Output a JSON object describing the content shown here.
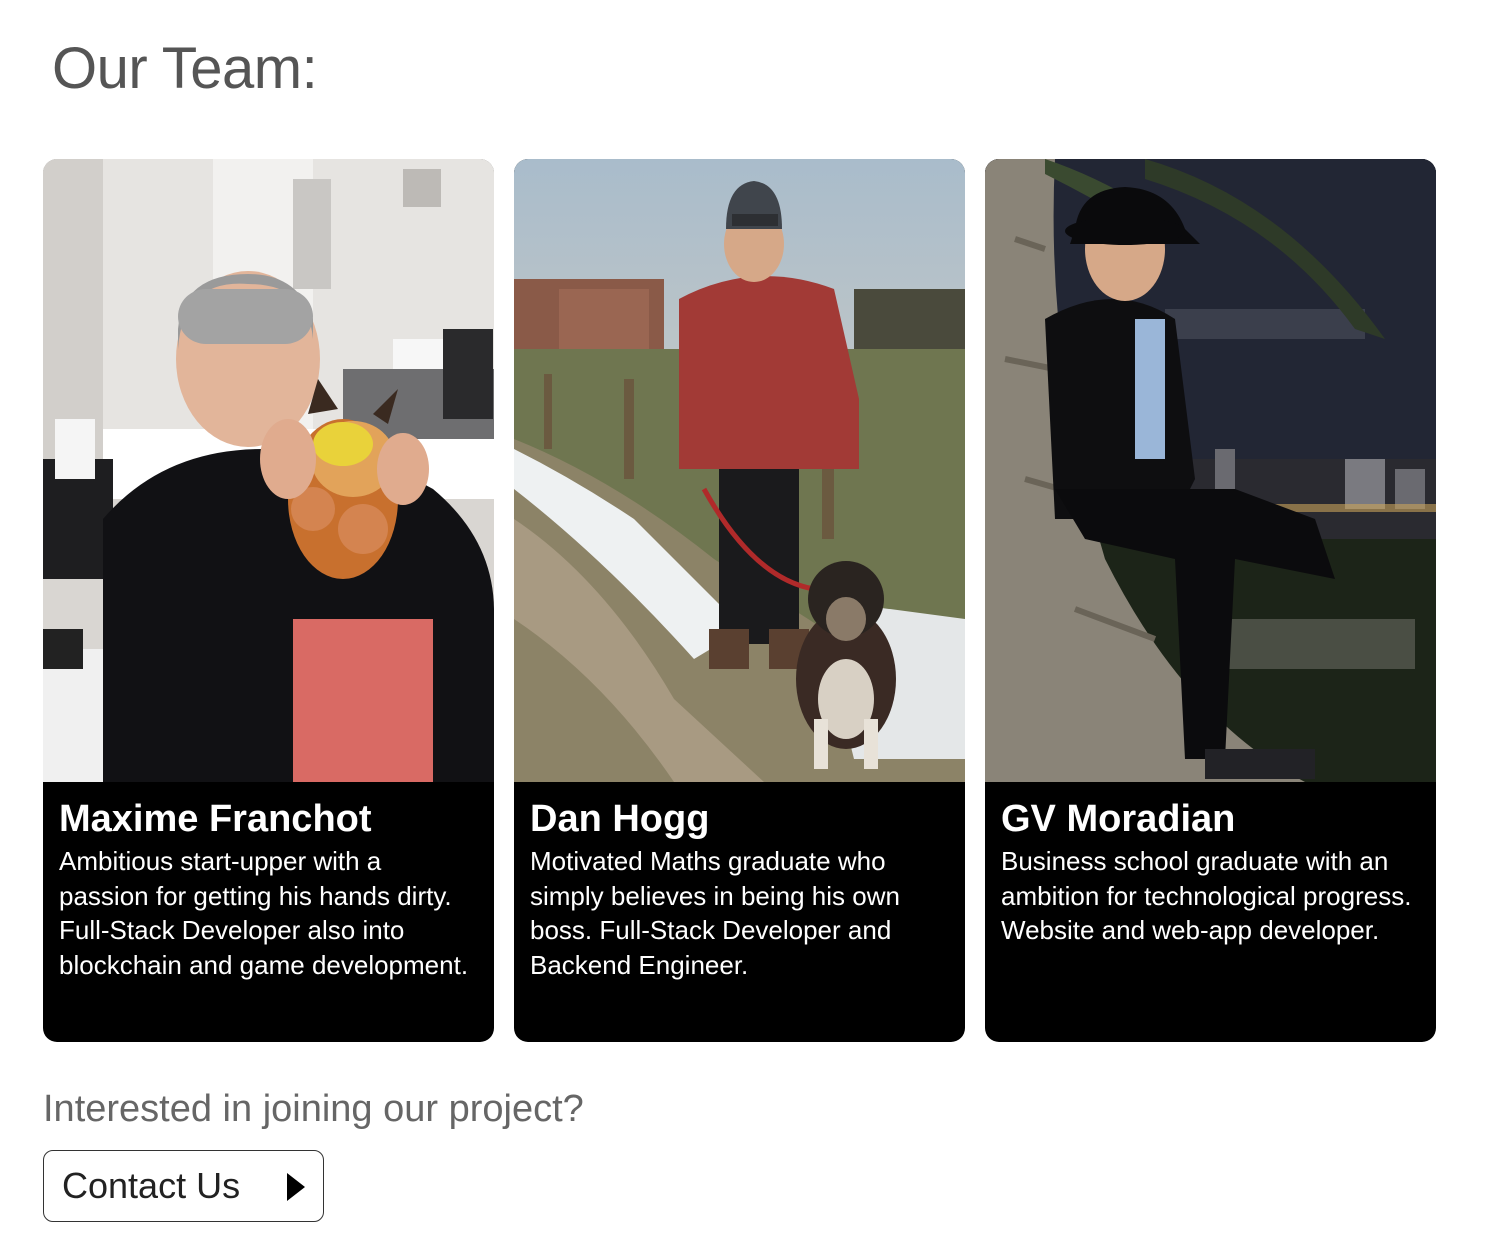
{
  "page": {
    "title": "Our Team:"
  },
  "team": [
    {
      "name": "Maxime Franchot",
      "description": "Ambitious start-upper with a passion for getting his hands dirty. Full-Stack Developer also into blockchain and game development.",
      "photo_icon": "person-with-plush-toy-photo"
    },
    {
      "name": "Dan Hogg",
      "description": "Motivated Maths graduate who simply believes in being his own boss. Full-Stack Developer and Backend Engineer.",
      "photo_icon": "person-with-dog-photo"
    },
    {
      "name": "GV Moradian",
      "description": "Business school graduate with an ambition for technological progress. Website and web-app developer.",
      "photo_icon": "person-on-palm-tree-photo"
    }
  ],
  "join": {
    "prompt": "Interested in joining our project?",
    "button_label": "Contact Us",
    "button_icon": "play-arrow-icon"
  },
  "colors": {
    "card_background": "#000000",
    "title_text": "#555555",
    "join_text": "#666666"
  }
}
